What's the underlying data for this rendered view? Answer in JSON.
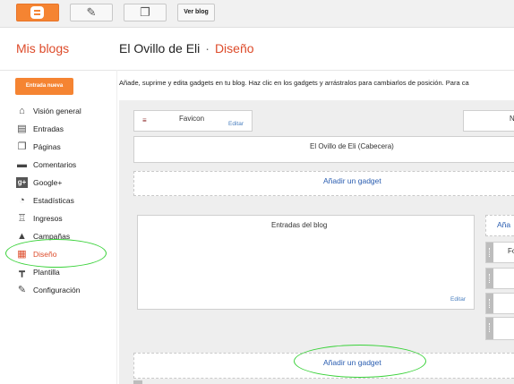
{
  "toolbar": {
    "blogger_icon": "blogger-logo-icon",
    "edit_icon": "pencil-icon",
    "pages_icon": "copy-icon",
    "view_blog_label": "Ver blog"
  },
  "header": {
    "my_blogs": "Mis blogs",
    "blog_name": "El Ovillo de Eli",
    "separator": "·",
    "section": "Diseño"
  },
  "sidebar": {
    "new_post_label": "Entrada nueva",
    "items": [
      {
        "label": "Visión general",
        "icon": "home-icon"
      },
      {
        "label": "Entradas",
        "icon": "posts-icon"
      },
      {
        "label": "Páginas",
        "icon": "pages-icon"
      },
      {
        "label": "Comentarios",
        "icon": "comment-icon"
      },
      {
        "label": "Google+",
        "icon": "google-plus-icon"
      },
      {
        "label": "Estadísticas",
        "icon": "pie-chart-icon"
      },
      {
        "label": "Ingresos",
        "icon": "trophy-icon"
      },
      {
        "label": "Campañas",
        "icon": "campaign-icon"
      },
      {
        "label": "Diseño",
        "icon": "layout-icon",
        "active": true
      },
      {
        "label": "Plantilla",
        "icon": "template-icon"
      },
      {
        "label": "Configuración",
        "icon": "wrench-icon"
      }
    ]
  },
  "main": {
    "description": "Añade, suprime y edita gadgets en tu blog. Haz clic en los gadgets y arrástralos para cambiarlos de posición. Para ca",
    "favicon": {
      "title": "Favicon",
      "edit": "Editar"
    },
    "navbar_partial": "N",
    "header_gadget": "El Ovillo de Eli (Cabecera)",
    "add_gadget_top": "Añadir un gadget",
    "blog_posts": {
      "title": "Entradas del blog",
      "edit": "Editar"
    },
    "sidebar_add_partial": "Aña",
    "sidebar_gadget_partial": "Fo",
    "add_gadget_bottom": "Añadir un gadget"
  },
  "colors": {
    "accent": "#f58432",
    "active_text": "#dd4b2a",
    "link": "#2a5db0",
    "highlight": "#3ad23a"
  }
}
